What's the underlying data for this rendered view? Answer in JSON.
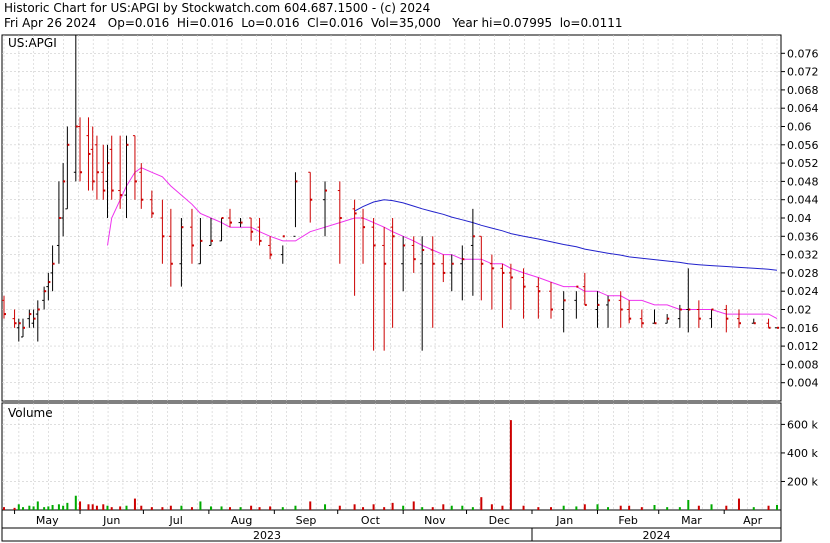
{
  "header": {
    "line1": "Historic Chart for US:APGI by Stockwatch.com 604.687.1500 - (c) 2024",
    "line2": "Fri Apr 26 2024   Op=0.016  Hi=0.016  Lo=0.016  Cl=0.016  Vol=35,000   Year hi=0.07995  lo=0.0111"
  },
  "colors": {
    "up": "#000000",
    "down": "#cc0000",
    "ma_short": "#ee33ee",
    "ma_long": "#2222cc",
    "vol_up": "#00aa00",
    "vol_down": "#cc0000",
    "grid": "#cccccc"
  },
  "chart_data": [
    {
      "type": "ohlc",
      "legend": "US:APGI",
      "ylim": [
        0,
        0.08
      ],
      "yticks": [
        "0.004",
        "0.008",
        "0.012",
        "0.016",
        "0.02",
        "0.024",
        "0.028",
        "0.032",
        "0.036",
        "0.04",
        "0.044",
        "0.048",
        "0.052",
        "0.056",
        "0.06",
        "0.064",
        "0.068",
        "0.072",
        "0.076"
      ],
      "grid": true,
      "x": [
        "2023-04-26",
        "2023-05-01",
        "2023-05-03",
        "2023-05-05",
        "2023-05-08",
        "2023-05-10",
        "2023-05-12",
        "2023-05-15",
        "2023-05-17",
        "2023-05-19",
        "2023-05-22",
        "2023-05-24",
        "2023-05-26",
        "2023-05-30",
        "2023-06-01",
        "2023-06-05",
        "2023-06-07",
        "2023-06-09",
        "2023-06-12",
        "2023-06-14",
        "2023-06-16",
        "2023-06-20",
        "2023-06-23",
        "2023-06-27",
        "2023-06-30",
        "2023-07-05",
        "2023-07-10",
        "2023-07-14",
        "2023-07-19",
        "2023-07-24",
        "2023-07-28",
        "2023-08-02",
        "2023-08-07",
        "2023-08-11",
        "2023-08-16",
        "2023-08-21",
        "2023-08-25",
        "2023-08-30",
        "2023-09-05",
        "2023-09-11",
        "2023-09-18",
        "2023-09-25",
        "2023-10-02",
        "2023-10-09",
        "2023-10-13",
        "2023-10-18",
        "2023-10-23",
        "2023-10-27",
        "2023-11-01",
        "2023-11-06",
        "2023-11-10",
        "2023-11-15",
        "2023-11-20",
        "2023-11-24",
        "2023-11-29",
        "2023-12-04",
        "2023-12-08",
        "2023-12-13",
        "2023-12-18",
        "2023-12-22",
        "2023-12-28",
        "2024-01-04",
        "2024-01-10",
        "2024-01-16",
        "2024-01-22",
        "2024-01-26",
        "2024-02-01",
        "2024-02-06",
        "2024-02-12",
        "2024-02-16",
        "2024-02-22",
        "2024-02-28",
        "2024-03-05",
        "2024-03-11",
        "2024-03-15",
        "2024-03-20",
        "2024-03-26",
        "2024-04-02",
        "2024-04-08",
        "2024-04-15",
        "2024-04-22",
        "2024-04-26"
      ],
      "open": [
        0.022,
        0.018,
        0.016,
        0.014,
        0.018,
        0.017,
        0.019,
        0.022,
        0.025,
        0.028,
        0.034,
        0.04,
        0.042,
        0.05,
        0.06,
        0.058,
        0.055,
        0.056,
        0.05,
        0.048,
        0.055,
        0.046,
        0.045,
        0.058,
        0.05,
        0.044,
        0.04,
        0.036,
        0.03,
        0.038,
        0.03,
        0.034,
        0.035,
        0.04,
        0.039,
        0.04,
        0.038,
        0.034,
        0.032,
        0.036,
        0.05,
        0.044,
        0.046,
        0.042,
        0.04,
        0.038,
        0.034,
        0.038,
        0.03,
        0.034,
        0.03,
        0.033,
        0.03,
        0.028,
        0.03,
        0.034,
        0.036,
        0.03,
        0.029,
        0.028,
        0.027,
        0.025,
        0.024,
        0.02,
        0.022,
        0.025,
        0.02,
        0.021,
        0.022,
        0.02,
        0.018,
        0.017,
        0.017,
        0.018,
        0.02,
        0.02,
        0.018,
        0.02,
        0.018,
        0.017,
        0.017,
        0.016
      ],
      "high": [
        0.023,
        0.02,
        0.018,
        0.018,
        0.02,
        0.02,
        0.022,
        0.025,
        0.028,
        0.034,
        0.048,
        0.052,
        0.06,
        0.08,
        0.062,
        0.062,
        0.06,
        0.058,
        0.056,
        0.056,
        0.058,
        0.058,
        0.058,
        0.058,
        0.052,
        0.046,
        0.044,
        0.042,
        0.04,
        0.042,
        0.04,
        0.04,
        0.04,
        0.042,
        0.04,
        0.04,
        0.04,
        0.036,
        0.034,
        0.05,
        0.05,
        0.048,
        0.048,
        0.044,
        0.042,
        0.04,
        0.038,
        0.04,
        0.036,
        0.036,
        0.036,
        0.036,
        0.032,
        0.032,
        0.034,
        0.042,
        0.036,
        0.032,
        0.03,
        0.03,
        0.029,
        0.027,
        0.026,
        0.024,
        0.024,
        0.028,
        0.024,
        0.023,
        0.024,
        0.022,
        0.02,
        0.02,
        0.019,
        0.021,
        0.029,
        0.022,
        0.02,
        0.021,
        0.02,
        0.018,
        0.018,
        0.016
      ],
      "low": [
        0.018,
        0.016,
        0.013,
        0.014,
        0.016,
        0.016,
        0.013,
        0.02,
        0.022,
        0.024,
        0.03,
        0.036,
        0.042,
        0.048,
        0.048,
        0.046,
        0.046,
        0.044,
        0.044,
        0.04,
        0.044,
        0.042,
        0.04,
        0.044,
        0.042,
        0.04,
        0.03,
        0.025,
        0.025,
        0.03,
        0.03,
        0.034,
        0.035,
        0.038,
        0.038,
        0.035,
        0.034,
        0.031,
        0.03,
        0.038,
        0.039,
        0.036,
        0.03,
        0.023,
        0.03,
        0.011,
        0.011,
        0.016,
        0.024,
        0.028,
        0.011,
        0.016,
        0.026,
        0.024,
        0.022,
        0.023,
        0.022,
        0.02,
        0.016,
        0.02,
        0.018,
        0.018,
        0.018,
        0.015,
        0.018,
        0.021,
        0.016,
        0.016,
        0.016,
        0.017,
        0.016,
        0.017,
        0.017,
        0.016,
        0.015,
        0.016,
        0.016,
        0.015,
        0.016,
        0.017,
        0.016,
        0.016
      ],
      "close": [
        0.019,
        0.017,
        0.017,
        0.016,
        0.019,
        0.018,
        0.02,
        0.024,
        0.026,
        0.03,
        0.04,
        0.048,
        0.056,
        0.06,
        0.05,
        0.054,
        0.048,
        0.05,
        0.046,
        0.052,
        0.046,
        0.045,
        0.056,
        0.048,
        0.044,
        0.041,
        0.036,
        0.03,
        0.038,
        0.034,
        0.035,
        0.035,
        0.04,
        0.039,
        0.039,
        0.037,
        0.035,
        0.032,
        0.036,
        0.048,
        0.044,
        0.046,
        0.04,
        0.041,
        0.038,
        0.034,
        0.03,
        0.036,
        0.034,
        0.031,
        0.033,
        0.03,
        0.028,
        0.03,
        0.031,
        0.036,
        0.03,
        0.029,
        0.028,
        0.027,
        0.025,
        0.024,
        0.02,
        0.022,
        0.025,
        0.021,
        0.021,
        0.022,
        0.02,
        0.018,
        0.017,
        0.017,
        0.018,
        0.02,
        0.02,
        0.018,
        0.02,
        0.018,
        0.017,
        0.017,
        0.016,
        0.016
      ],
      "ma_short": [
        null,
        null,
        null,
        null,
        null,
        null,
        null,
        null,
        null,
        null,
        null,
        null,
        null,
        null,
        null,
        null,
        null,
        null,
        null,
        0.034,
        0.04,
        0.044,
        0.047,
        0.05,
        0.051,
        0.05,
        0.049,
        0.047,
        0.045,
        0.043,
        0.041,
        0.04,
        0.039,
        0.038,
        0.038,
        0.038,
        0.037,
        0.036,
        0.035,
        0.035,
        0.037,
        0.038,
        0.039,
        0.04,
        0.04,
        0.039,
        0.038,
        0.037,
        0.036,
        0.035,
        0.034,
        0.033,
        0.032,
        0.032,
        0.031,
        0.031,
        0.031,
        0.03,
        0.03,
        0.029,
        0.028,
        0.027,
        0.026,
        0.025,
        0.025,
        0.024,
        0.024,
        0.023,
        0.023,
        0.022,
        0.022,
        0.021,
        0.021,
        0.02,
        0.02,
        0.02,
        0.02,
        0.019,
        0.019,
        0.019,
        0.019,
        0.018
      ],
      "ma_long": [
        null,
        null,
        null,
        null,
        null,
        null,
        null,
        null,
        null,
        null,
        null,
        null,
        null,
        null,
        null,
        null,
        null,
        null,
        null,
        null,
        null,
        null,
        null,
        null,
        null,
        null,
        null,
        null,
        null,
        null,
        null,
        null,
        null,
        null,
        null,
        null,
        null,
        null,
        null,
        null,
        null,
        null,
        null,
        0.0415,
        0.0425,
        0.0435,
        0.044,
        0.0438,
        0.0433,
        0.0426,
        0.042,
        0.0414,
        0.0408,
        0.0402,
        0.0396,
        0.039,
        0.0384,
        0.0378,
        0.0372,
        0.0366,
        0.036,
        0.0354,
        0.0348,
        0.0342,
        0.0337,
        0.0332,
        0.0327,
        0.0323,
        0.0319,
        0.0315,
        0.0312,
        0.0309,
        0.0306,
        0.0303,
        0.03,
        0.0298,
        0.0296,
        0.0294,
        0.0292,
        0.029,
        0.0288,
        0.0286
      ]
    },
    {
      "type": "bar",
      "title": "Volume",
      "yticks": [
        "200 k",
        "400 k",
        "600 k"
      ],
      "ylim": [
        0,
        750
      ],
      "grid": true,
      "values": [
        20,
        15,
        40,
        20,
        30,
        25,
        60,
        20,
        25,
        35,
        40,
        30,
        50,
        100,
        60,
        40,
        40,
        30,
        40,
        30,
        20,
        25,
        30,
        80,
        30,
        20,
        20,
        30,
        30,
        20,
        60,
        25,
        25,
        20,
        20,
        30,
        20,
        25,
        20,
        30,
        60,
        40,
        30,
        40,
        20,
        40,
        20,
        50,
        30,
        60,
        20,
        20,
        40,
        30,
        30,
        20,
        90,
        40,
        30,
        630,
        30,
        20,
        20,
        30,
        25,
        40,
        40,
        20,
        30,
        30,
        20,
        35,
        20,
        20,
        70,
        30,
        40,
        30,
        80,
        20,
        30,
        35
      ]
    },
    {
      "type": "axis",
      "months": [
        "May",
        "Jun",
        "Jul",
        "Aug",
        "Sep",
        "Oct",
        "Nov",
        "Dec",
        "Jan",
        "Feb",
        "Mar",
        "Apr"
      ],
      "years": [
        "2023",
        "2024"
      ]
    }
  ]
}
